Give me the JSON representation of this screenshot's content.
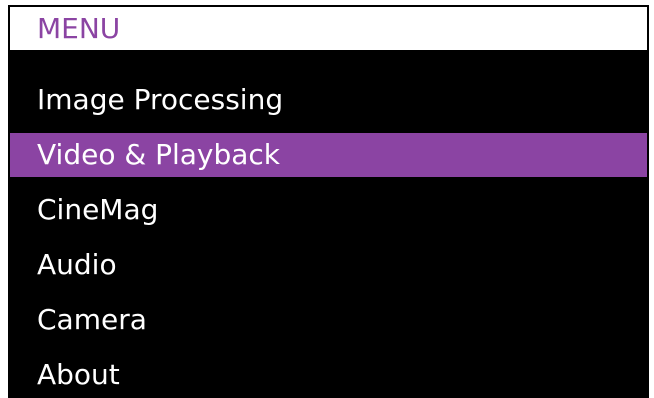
{
  "header": {
    "title": "MENU",
    "title_color": "#8b44a3"
  },
  "menu": {
    "selected_index": 1,
    "highlight_color": "#8b44a3",
    "items": [
      {
        "label": "Image Processing"
      },
      {
        "label": "Video & Playback"
      },
      {
        "label": "CineMag"
      },
      {
        "label": "Audio"
      },
      {
        "label": "Camera"
      },
      {
        "label": "About"
      }
    ]
  }
}
